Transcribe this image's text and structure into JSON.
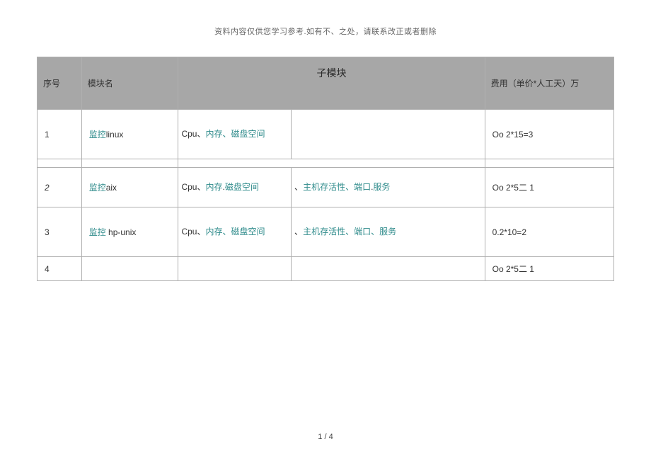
{
  "disclaimer": "资料内容仅供您学习参考.如有不、之处，请联系改正或者删除",
  "header": {
    "seq": "序号",
    "name": "模块名",
    "sub": "子模块",
    "fee": "费用（单价*人工天）万"
  },
  "rows": [
    {
      "seq": "1",
      "name_teal": "监控",
      "name_black": "linux",
      "sub1_pre": " Cpu、",
      "sub1_teal": "内存、磁盘空间",
      "sub2": "",
      "fee": "Oo 2*15=3"
    },
    {
      "seq": "2",
      "seq_italic": true,
      "name_teal": "监控",
      "name_black": "aix",
      "sub1_pre": " Cpu、",
      "sub1_teal1": "内存",
      "sub1_mid": ".",
      "sub1_teal2": "磁盘空间",
      "sub2_pre": "、",
      "sub2_teal1": "主机存活性、端口",
      "sub2_mid": ".",
      "sub2_teal2": "服务",
      "fee": "Oo 2*5二  1",
      "has_top_spacer": true
    },
    {
      "seq": "3",
      "name_teal": "监控",
      "name_black": "  hp-unix",
      "sub1_pre": " Cpu、",
      "sub1_teal": "内存、磁盘空间",
      "sub2_pre": "、",
      "sub2_teal": "主机存活性、端口、服务",
      "fee": "0.2*10=2"
    },
    {
      "seq": "4",
      "name": "",
      "sub1": "",
      "sub2": "",
      "fee": "Oo 2*5二  1",
      "small": true
    }
  ],
  "page_number": "1 / 4"
}
